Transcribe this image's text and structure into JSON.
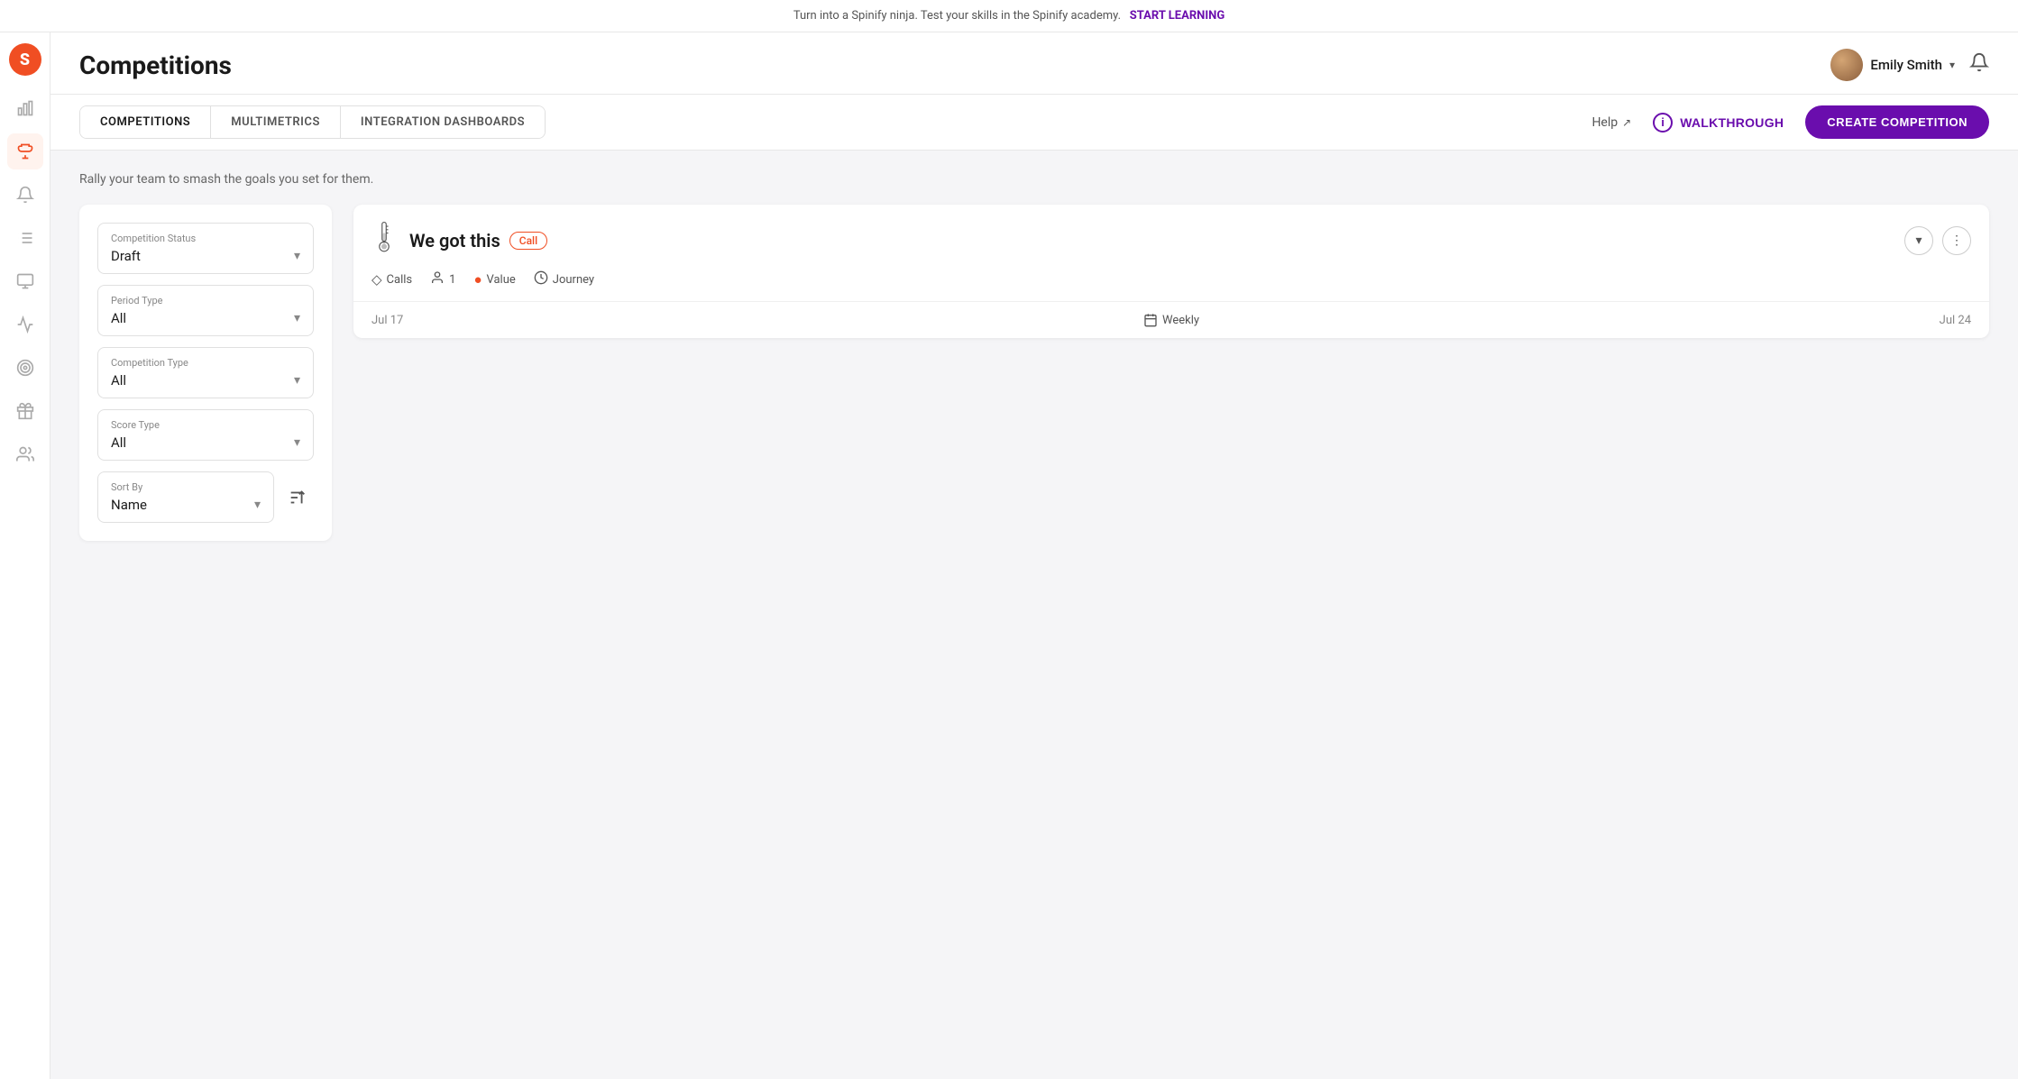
{
  "banner": {
    "text": "Turn into a Spinify ninja. Test your skills in the Spinify academy.",
    "cta": "START LEARNING"
  },
  "header": {
    "title": "Competitions",
    "user": {
      "name": "Emily Smith",
      "chevron": "▾"
    },
    "bell": "🔔"
  },
  "tabs": [
    {
      "id": "competitions",
      "label": "COMPETITIONS",
      "active": true
    },
    {
      "id": "multimetrics",
      "label": "MULTIMETRICS",
      "active": false
    },
    {
      "id": "integration-dashboards",
      "label": "INTEGRATION DASHBOARDS",
      "active": false
    }
  ],
  "sub_header": {
    "help": "Help",
    "walkthrough": "WALKTHROUGH",
    "create": "CREATE COMPETITION"
  },
  "tagline": "Rally your team to smash the goals you set for them.",
  "filters": {
    "competition_status": {
      "label": "Competition Status",
      "value": "Draft"
    },
    "period_type": {
      "label": "Period Type",
      "value": "All"
    },
    "competition_type": {
      "label": "Competition Type",
      "value": "All"
    },
    "score_type": {
      "label": "Score Type",
      "value": "All"
    },
    "sort_by": {
      "label": "Sort By",
      "value": "Name"
    }
  },
  "competitions": [
    {
      "id": 1,
      "title": "We got this",
      "badge": "Call",
      "meta": [
        {
          "icon": "◇",
          "label": "Calls"
        },
        {
          "icon": "👤",
          "label": "1",
          "count": true
        },
        {
          "icon": "●",
          "label": "Value",
          "orange": true
        },
        {
          "icon": "⟳",
          "label": "Journey"
        }
      ],
      "date_start": "Jul 17",
      "period": "Weekly",
      "date_end": "Jul 24"
    }
  ],
  "sidebar": {
    "logo": "S",
    "items": [
      {
        "id": "bar-chart",
        "icon": "▦",
        "label": "analytics",
        "active": false
      },
      {
        "id": "trophy",
        "icon": "🏆",
        "label": "competitions",
        "active": true
      },
      {
        "id": "megaphone",
        "icon": "📢",
        "label": "announcements",
        "active": false
      },
      {
        "id": "list",
        "icon": "☰",
        "label": "feeds",
        "active": false
      },
      {
        "id": "monitor",
        "icon": "🖥",
        "label": "screens",
        "active": false
      },
      {
        "id": "chart-line",
        "icon": "📈",
        "label": "reports",
        "active": false
      },
      {
        "id": "target",
        "icon": "🎯",
        "label": "targets",
        "active": false
      },
      {
        "id": "gift",
        "icon": "🎁",
        "label": "rewards",
        "active": false
      },
      {
        "id": "users",
        "icon": "👥",
        "label": "users",
        "active": false
      }
    ]
  }
}
